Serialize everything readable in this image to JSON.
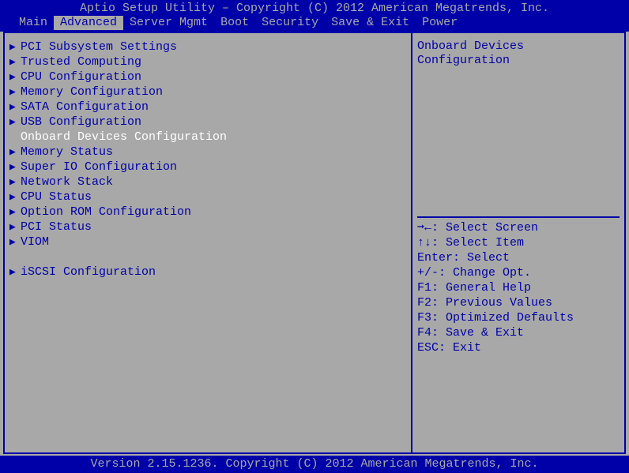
{
  "header": "Aptio Setup Utility – Copyright (C) 2012 American Megatrends, Inc.",
  "footer": "Version 2.15.1236. Copyright (C) 2012 American Megatrends, Inc.",
  "tabs": [
    "Main",
    "Advanced",
    "Server Mgmt",
    "Boot",
    "Security",
    "Save & Exit",
    "Power"
  ],
  "active_tab": 1,
  "menu": [
    {
      "label": "PCI Subsystem Settings"
    },
    {
      "label": "Trusted Computing"
    },
    {
      "label": "CPU Configuration"
    },
    {
      "label": "Memory Configuration"
    },
    {
      "label": "SATA Configuration"
    },
    {
      "label": "USB Configuration"
    },
    {
      "label": "Onboard Devices Configuration",
      "selected": true
    },
    {
      "label": "Memory Status"
    },
    {
      "label": "Super IO Configuration"
    },
    {
      "label": "Network Stack"
    },
    {
      "label": "CPU Status"
    },
    {
      "label": "Option ROM Configuration"
    },
    {
      "label": "PCI Status"
    },
    {
      "label": "VIOM"
    },
    {
      "gap": true
    },
    {
      "label": "iSCSI Configuration"
    }
  ],
  "description": "Onboard Devices Configuration",
  "help": [
    "➞←: Select Screen",
    "↑↓: Select Item",
    "Enter: Select",
    "+/-: Change Opt.",
    "F1: General Help",
    "F2: Previous Values",
    "F3: Optimized Defaults",
    "F4: Save & Exit",
    "ESC: Exit"
  ]
}
